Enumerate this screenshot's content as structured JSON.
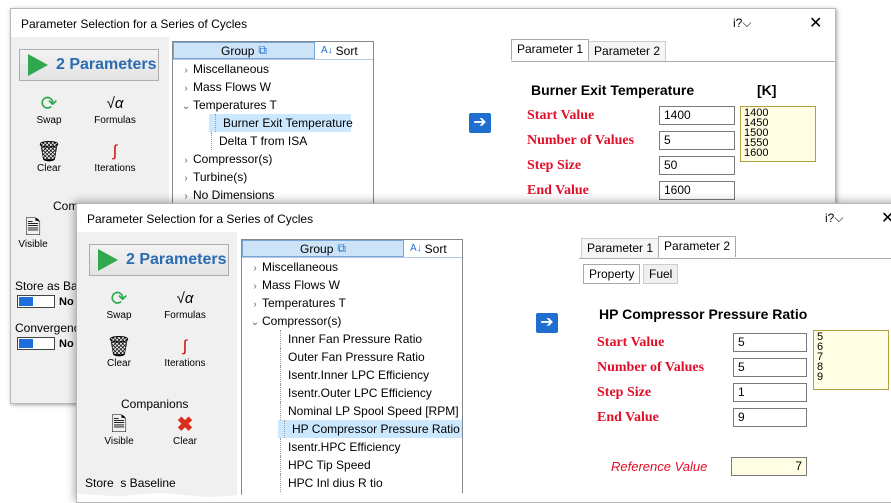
{
  "window1": {
    "title": "Parameter Selection for a Series of Cycles",
    "help": "i?",
    "close": "✕",
    "run_button": "2 Parameters",
    "tools": {
      "swap": "Swap",
      "formulas": "Formulas",
      "clear": "Clear",
      "iterations": "Iterations"
    },
    "companions_partial": "Com",
    "visible": "Visible",
    "store_as_partial": "Store as Ba",
    "store_value": "No",
    "convergence_partial": "Convergenc",
    "convergence_value": "No",
    "tree": {
      "group": "Group",
      "sort": "Sort",
      "rows": [
        {
          "label": "Miscellaneous",
          "exp": "›",
          "level": 0
        },
        {
          "label": "Mass Flows W",
          "exp": "›",
          "level": 0
        },
        {
          "label": "Temperatures T",
          "exp": "⌄",
          "level": 0
        },
        {
          "label": "Burner Exit Temperature",
          "exp": "",
          "level": 1,
          "selected": true
        },
        {
          "label": "Delta T from ISA",
          "exp": "",
          "level": 1
        },
        {
          "label": "Compressor(s)",
          "exp": "›",
          "level": 0
        },
        {
          "label": "Turbine(s)",
          "exp": "›",
          "level": 0
        },
        {
          "label": "No Dimensions",
          "exp": "›",
          "level": 0
        }
      ]
    },
    "tabs": [
      "Parameter 1",
      "Parameter 2"
    ],
    "param_name": "Burner Exit Temperature",
    "unit": "[K]",
    "fields": [
      {
        "label": "Start Value",
        "value": "1400"
      },
      {
        "label": "Number of Values",
        "value": "5"
      },
      {
        "label": "Step Size",
        "value": "50"
      },
      {
        "label": "End Value",
        "value": "1600"
      }
    ],
    "values_list": [
      "1400",
      "1450",
      "1500",
      "1550",
      "1600"
    ]
  },
  "window2": {
    "title": "Parameter Selection for a Series of Cycles",
    "help": "i?",
    "close": "✕",
    "run_button": "2 Parameters",
    "tools": {
      "swap": "Swap",
      "formulas": "Formulas",
      "clear": "Clear",
      "iterations": "Iterations"
    },
    "companions": "Companions",
    "visible": "Visible",
    "clear2": "Clear",
    "store_partial": "Store  s Baseline",
    "tree": {
      "group": "Group",
      "sort": "Sort",
      "rows": [
        {
          "label": "Miscellaneous",
          "exp": "›",
          "level": 0
        },
        {
          "label": "Mass Flows W",
          "exp": "›",
          "level": 0
        },
        {
          "label": "Temperatures T",
          "exp": "›",
          "level": 0
        },
        {
          "label": "Compressor(s)",
          "exp": "⌄",
          "level": 0
        },
        {
          "label": "Inner Fan Pressure Ratio",
          "exp": "",
          "level": 1
        },
        {
          "label": "Outer Fan Pressure Ratio",
          "exp": "",
          "level": 1
        },
        {
          "label": "Isentr.Inner LPC Efficiency",
          "exp": "",
          "level": 1
        },
        {
          "label": "Isentr.Outer LPC Efficiency",
          "exp": "",
          "level": 1
        },
        {
          "label": "Nominal LP Spool Speed [RPM]",
          "exp": "",
          "level": 1
        },
        {
          "label": "HP Compressor Pressure Ratio",
          "exp": "",
          "level": 1,
          "selected": true
        },
        {
          "label": "Isentr.HPC Efficiency",
          "exp": "",
          "level": 1
        },
        {
          "label": "HPC Tip Speed",
          "exp": "",
          "level": 1
        },
        {
          "label": "HPC Inl    dius R  tio",
          "exp": "",
          "level": 1
        }
      ]
    },
    "tabs": [
      "Parameter 1",
      "Parameter 2"
    ],
    "subtabs": [
      "Property",
      "Fuel"
    ],
    "param_name": "HP Compressor Pressure Ratio",
    "fields": [
      {
        "label": "Start Value",
        "value": "5"
      },
      {
        "label": "Number of Values",
        "value": "5"
      },
      {
        "label": "Step Size",
        "value": "1"
      },
      {
        "label": "End Value",
        "value": "9"
      }
    ],
    "values_list": [
      "5",
      "6",
      "7",
      "8",
      "9"
    ],
    "reference_label": "Reference Value",
    "reference_value": "7"
  }
}
